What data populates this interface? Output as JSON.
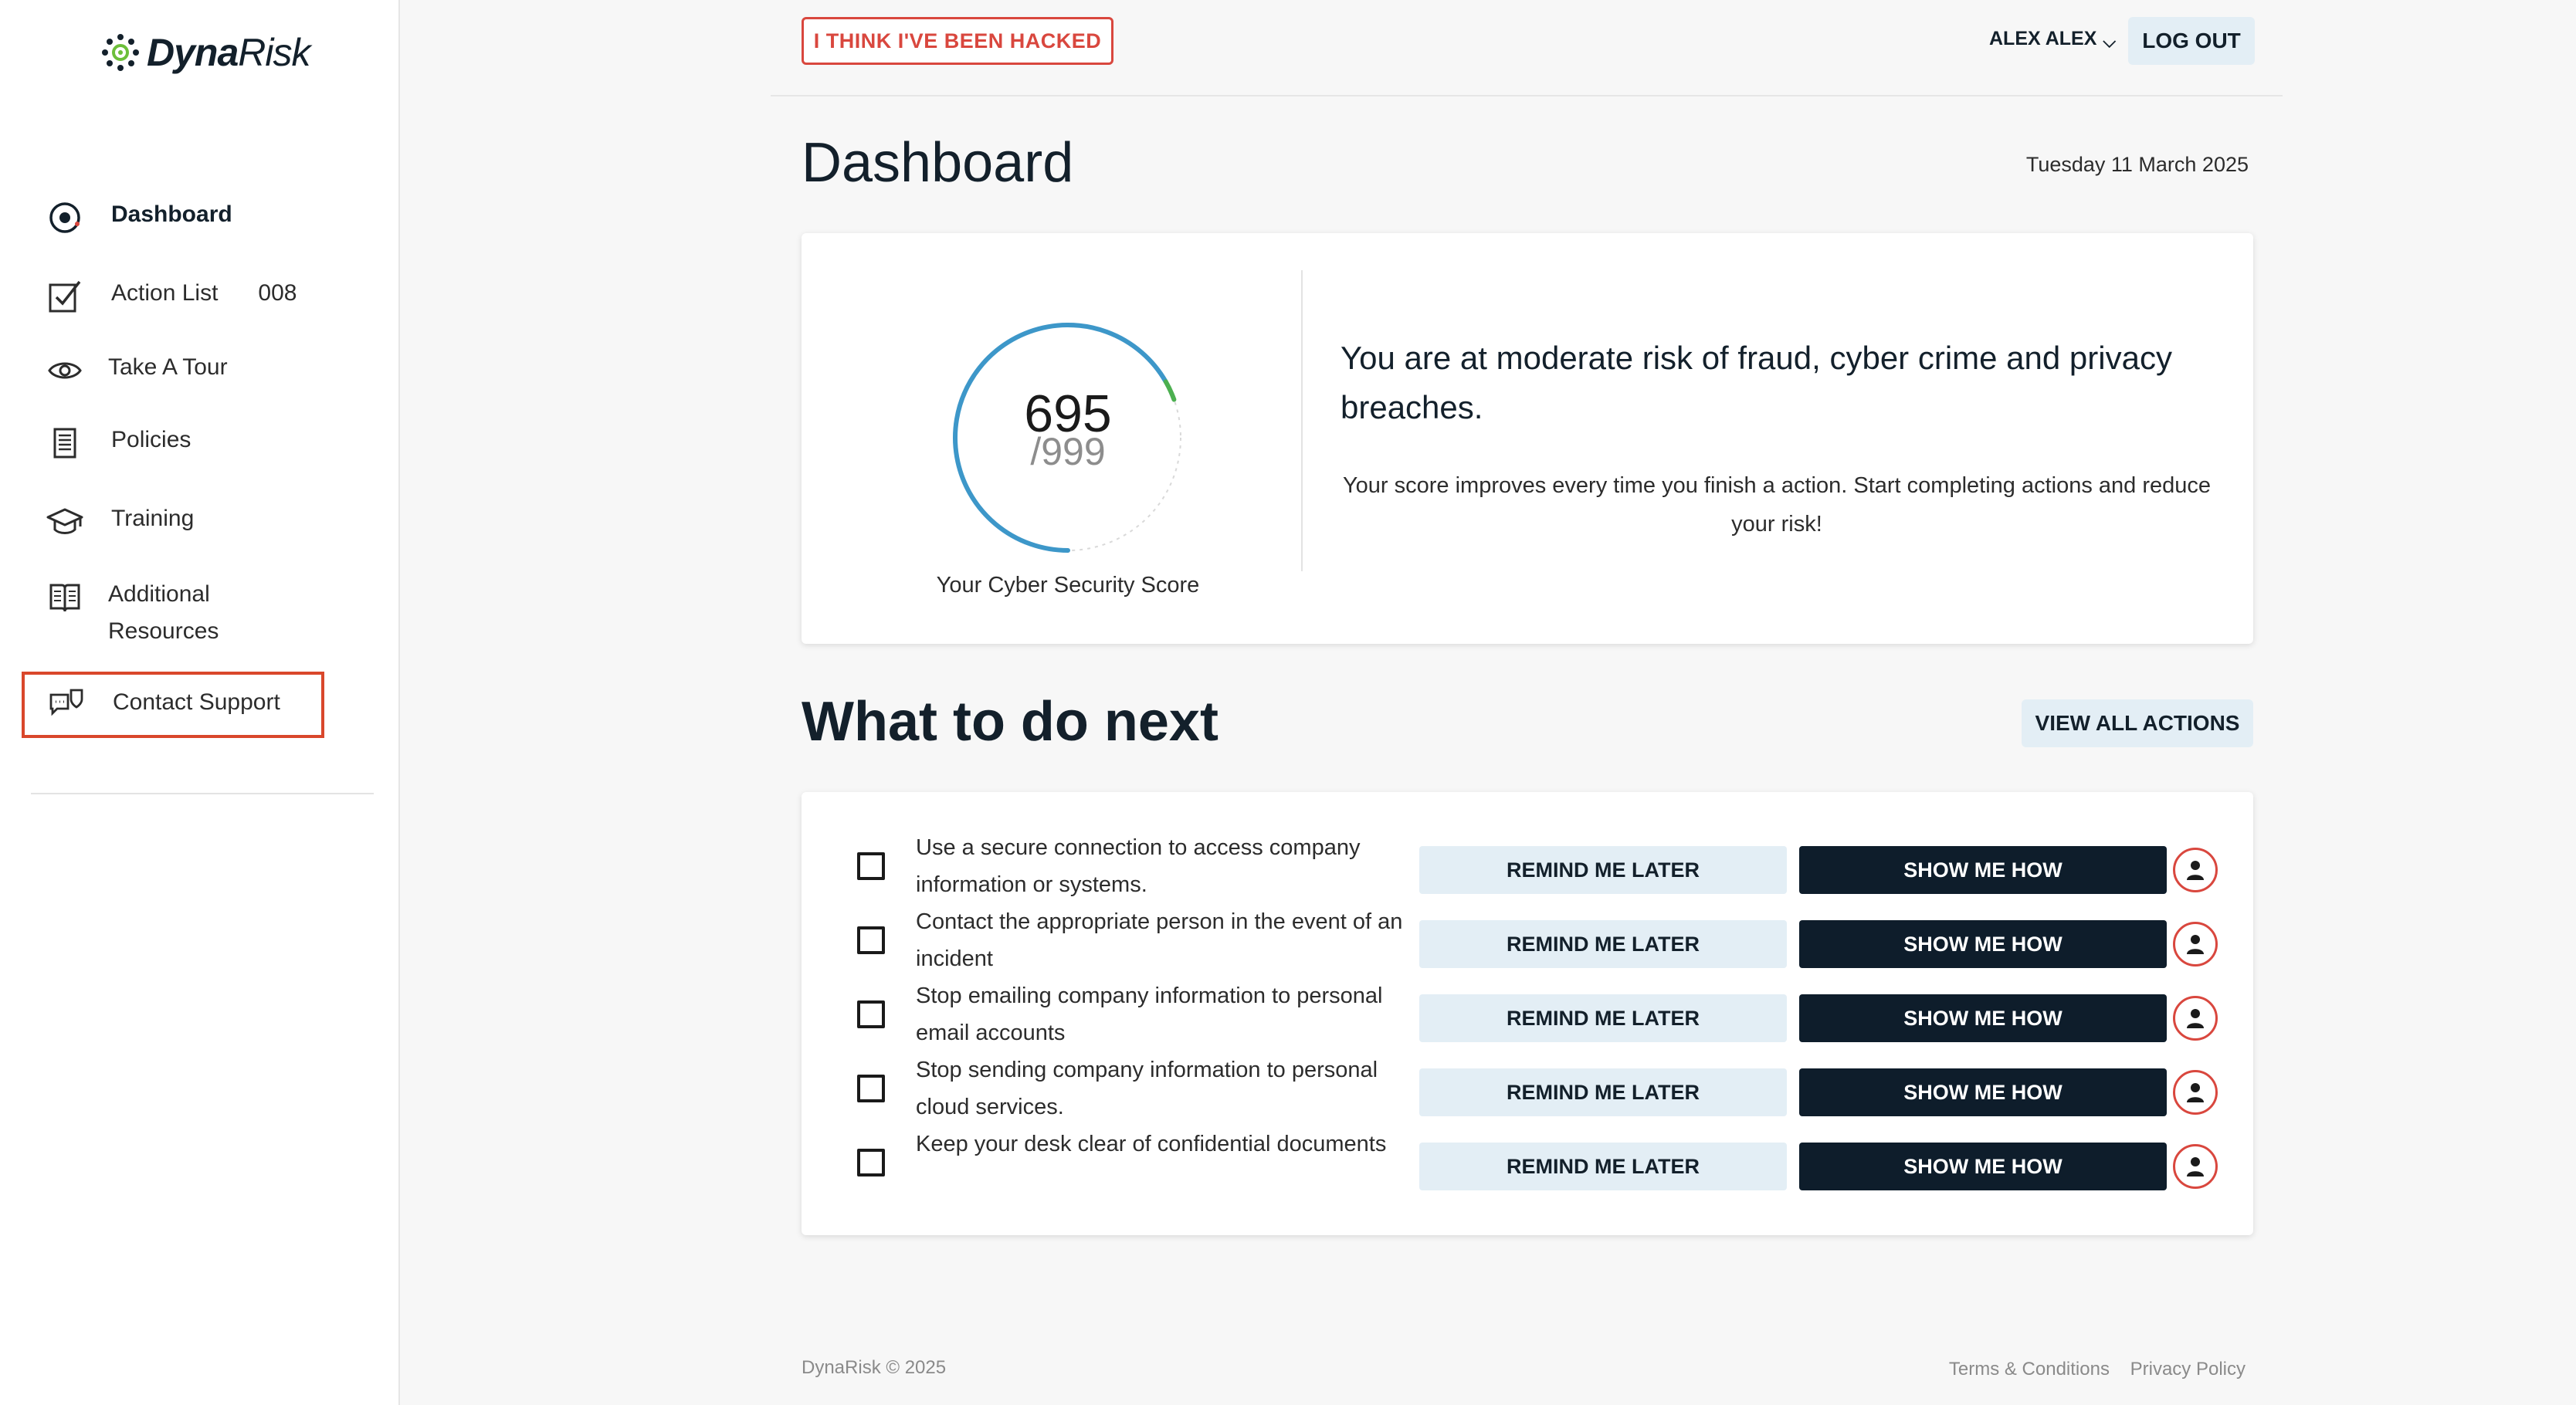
{
  "brand": {
    "name_bold": "Dyna",
    "name_light": "Risk"
  },
  "sidebar": {
    "items": [
      {
        "label": "Dashboard",
        "icon": "dashboard-icon",
        "active": true
      },
      {
        "label": "Action List",
        "count": "008",
        "icon": "checklist-icon"
      },
      {
        "label": "Take A Tour",
        "icon": "eye-icon"
      },
      {
        "label": "Policies",
        "icon": "document-icon"
      },
      {
        "label": "Training",
        "icon": "graduation-cap-icon"
      },
      {
        "label": "Additional",
        "label2": "Resources",
        "icon": "book-icon"
      },
      {
        "label": "Contact Support",
        "icon": "chat-support-icon",
        "highlighted": true
      }
    ]
  },
  "topbar": {
    "hacked_label": "I THINK I'VE BEEN HACKED",
    "user_name": "ALEX ALEX",
    "logout_label": "LOG OUT"
  },
  "header": {
    "title": "Dashboard",
    "date": "Tuesday 11 March 2025"
  },
  "score": {
    "value": "695",
    "max": "/999",
    "fraction": 0.695,
    "caption": "Your Cyber Security Score",
    "risk_title": "You are at moderate risk of fraud, cyber crime and privacy breaches.",
    "risk_body": "Your score improves every time you finish a action. Start completing actions and reduce your risk!",
    "colors": {
      "arc": "#3d97c9",
      "arc_tip": "#4caf50",
      "track": "#d9d9d9"
    }
  },
  "next": {
    "title": "What to do next",
    "view_all_label": "VIEW ALL ACTIONS",
    "remind_label": "REMIND ME LATER",
    "show_label": "SHOW ME HOW",
    "actions": [
      {
        "text": "Use a secure connection to access company information or systems."
      },
      {
        "text": "Contact the appropriate person in the event of an incident"
      },
      {
        "text": "Stop emailing company information to personal email accounts"
      },
      {
        "text": "Stop sending company information to personal cloud services."
      },
      {
        "text": "Keep your desk clear of confidential documents"
      }
    ]
  },
  "footer": {
    "copyright": "DynaRisk © 2025",
    "terms": "Terms & Conditions",
    "privacy": "Privacy Policy"
  },
  "colors": {
    "accent_red": "#d9473e",
    "navy": "#0e1d2b",
    "light_blue": "#e3eef5"
  }
}
